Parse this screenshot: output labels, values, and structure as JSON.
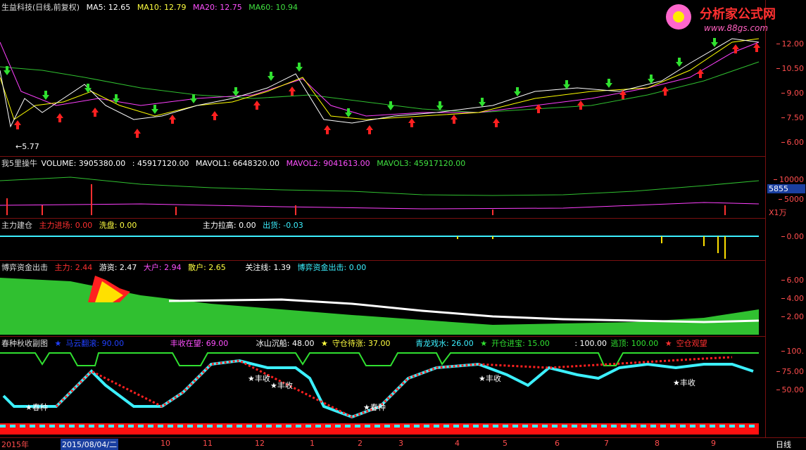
{
  "main": {
    "title": "生益科技(日线,前复权)",
    "ma5": "MA5: 12.65",
    "ma10": "MA10: 12.79",
    "ma20": "MA20: 12.75",
    "ma60": "MA60: 10.94",
    "low_label": "←5.77",
    "axis": [
      "12.00",
      "10.50",
      "9.00",
      "7.50",
      "6.00"
    ]
  },
  "volume": {
    "label": "我5里操牛",
    "vol": "VOLUME: 3905380.00",
    "v2": ": 45917120.00",
    "mavol1": "MAVOL1: 6648320.00",
    "mavol2": "MAVOL2: 9041613.00",
    "mavol3": "MAVOL3: 45917120.00",
    "axis": [
      "10000",
      "5000"
    ],
    "current": "5855",
    "unit": "X1万"
  },
  "force": {
    "label": "主力建仓",
    "entry": "主力进场: 0.00",
    "wash": "洗盘: 0.00",
    "pull": "主力拉高: 0.00",
    "out": "出货: -0.03",
    "axis": [
      "0.00"
    ]
  },
  "game": {
    "label": "博弈资金出击",
    "main": "主力: 2.44",
    "free": "游资: 2.47",
    "big": "大户: 2.94",
    "retail": "散户: 2.65",
    "focus": "关注线: 1.39",
    "strike": "博弈资金出击: 0.00",
    "axis": [
      "6.00",
      "4.00",
      "2.00"
    ]
  },
  "season": {
    "label": "春种秋收副图",
    "horse": "马云翻滚: 90.00",
    "harvest": "丰收在望: 69.00",
    "iceberg": "冰山沉船: 48.00",
    "wait": "守仓待涨: 37.00",
    "dragon": "青龙戏水: 26.00",
    "open": "开仓进宝: 15.00",
    "val100": ": 100.00",
    "escape": "逃顶: 100.00",
    "empty": "空仓观望",
    "axis": [
      "100.",
      "75.00",
      "50.00"
    ],
    "marks": {
      "harvest": "丰收",
      "spring": "春种"
    }
  },
  "timeline": {
    "labels": [
      "2015年",
      "2015/08/04/二",
      "10",
      "11",
      "12",
      "1",
      "2",
      "3",
      "4",
      "5",
      "6",
      "7",
      "8",
      "9"
    ],
    "period": "日线"
  },
  "colors": {
    "up": "#ff2020",
    "down": "#3cf0ff",
    "ma5": "#ffffff",
    "ma10": "#ffff00",
    "ma20": "#ff40ff",
    "ma60": "#30d030"
  }
}
